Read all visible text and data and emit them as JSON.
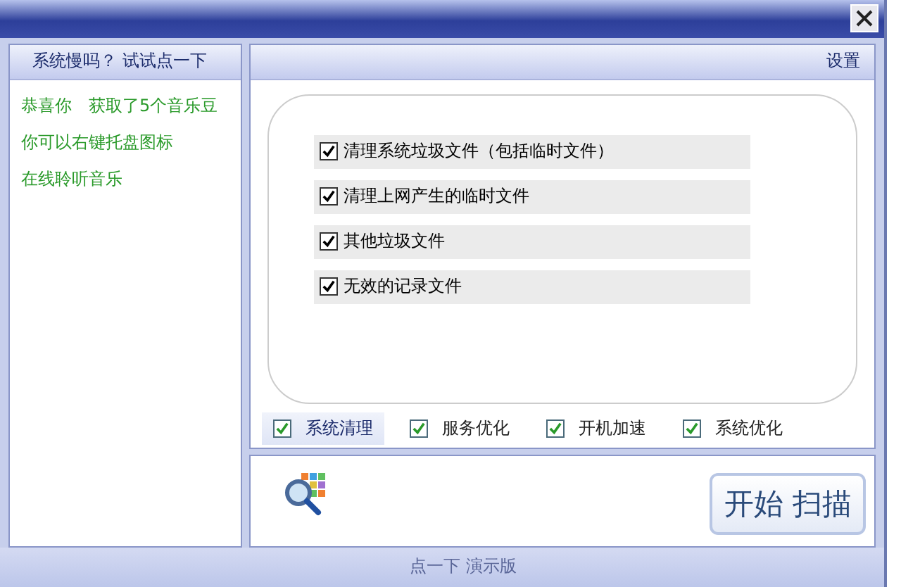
{
  "left_panel": {
    "title": "系统慢吗？ 试试点一下",
    "messages": [
      "恭喜你　获取了5个音乐豆",
      "你可以右键托盘图标",
      "在线聆听音乐"
    ]
  },
  "right_panel": {
    "title": "设置",
    "options": [
      {
        "label": "清理系统垃圾文件（包括临时文件）",
        "checked": true
      },
      {
        "label": "清理上网产生的临时文件",
        "checked": true
      },
      {
        "label": "其他垃圾文件",
        "checked": true
      },
      {
        "label": "无效的记录文件",
        "checked": true
      }
    ],
    "tabs": [
      {
        "label": "系统清理",
        "checked": true,
        "selected": true
      },
      {
        "label": "服务优化",
        "checked": true,
        "selected": false
      },
      {
        "label": "开机加速",
        "checked": true,
        "selected": false
      },
      {
        "label": "系统优化",
        "checked": true,
        "selected": false
      }
    ]
  },
  "start_button": "开始 扫描",
  "footer": "点一下 演示版"
}
